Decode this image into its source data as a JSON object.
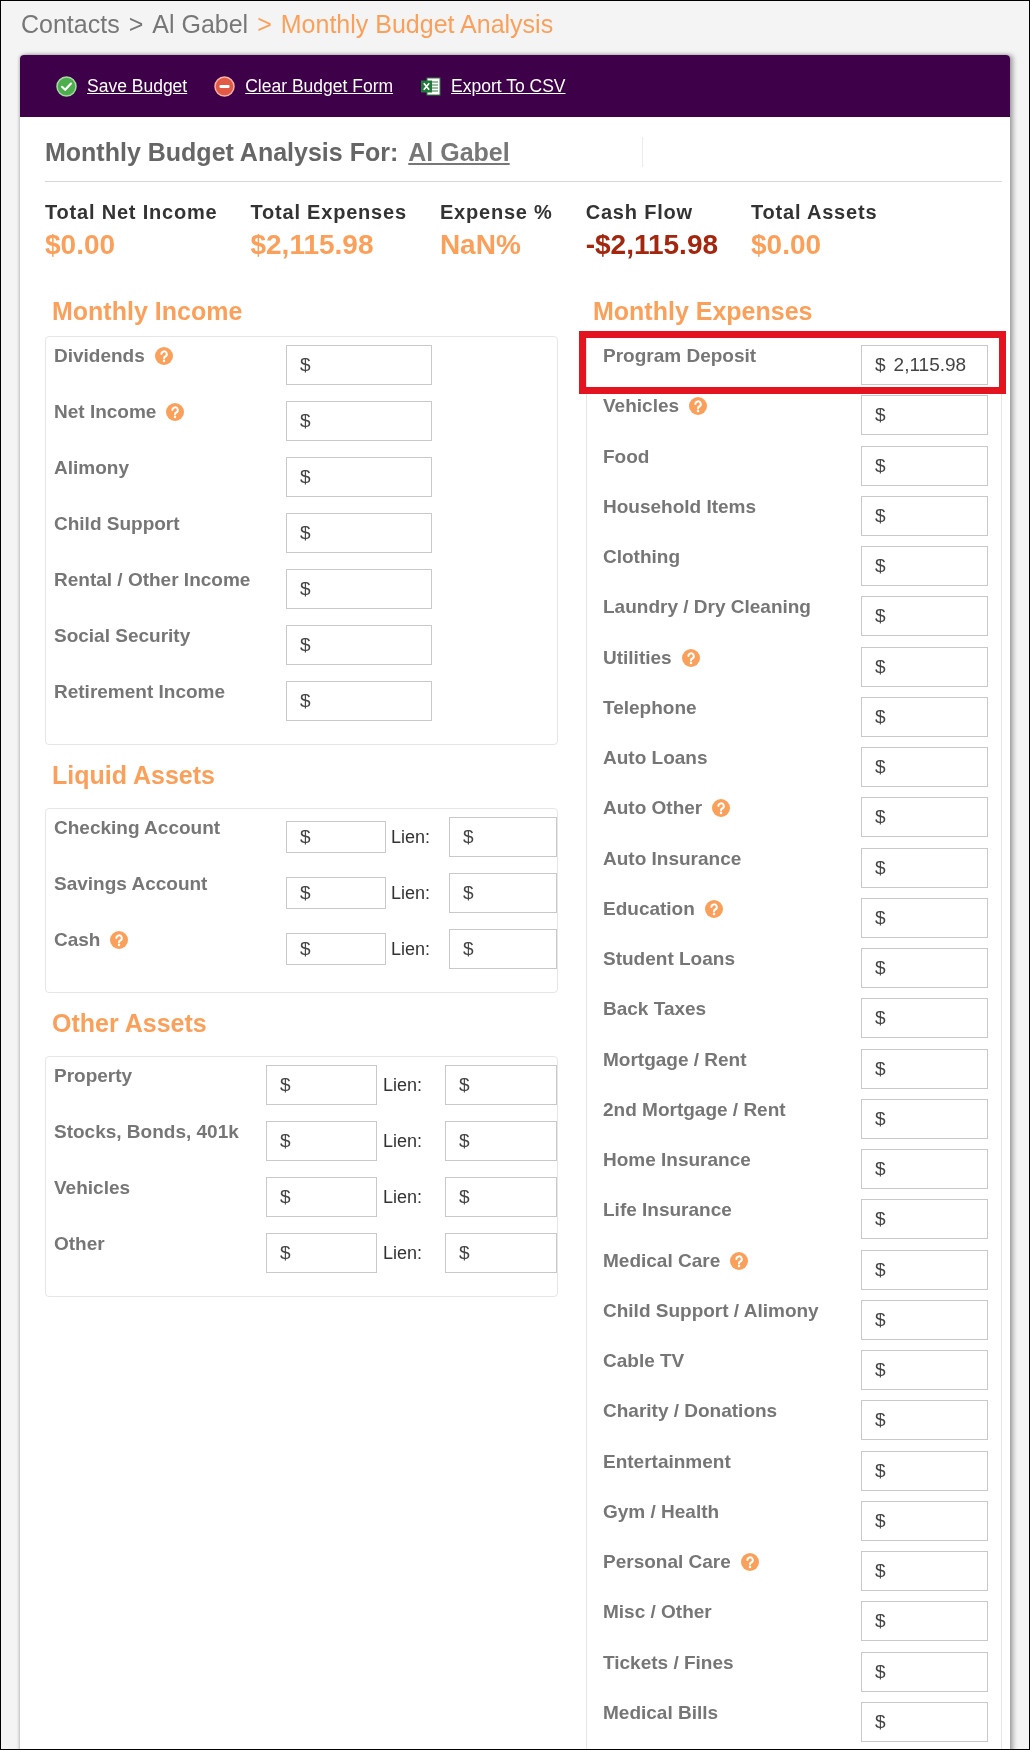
{
  "breadcrumb": [
    {
      "label": "Contacts",
      "current": false
    },
    {
      "separator": ">",
      "label": "Al Gabel",
      "current": false
    },
    {
      "separator": ">",
      "label": "Monthly Budget Analysis",
      "current": true
    }
  ],
  "toolbar": [
    {
      "kind": "save",
      "label": "Save Budget"
    },
    {
      "kind": "clear",
      "label": "Clear Budget Form"
    },
    {
      "kind": "export",
      "label": "Export To CSV"
    }
  ],
  "heading": {
    "label": "Monthly Budget Analysis For:",
    "client": "Al Gabel"
  },
  "summary": [
    {
      "label": "Total Net Income",
      "value": "$0.00",
      "negative": false
    },
    {
      "label": "Total Expenses",
      "value": "$2,115.98",
      "negative": false
    },
    {
      "label": "Expense %",
      "value": "NaN%",
      "negative": false
    },
    {
      "label": "Cash Flow",
      "value": "-$2,115.98",
      "negative": true
    },
    {
      "label": "Total Assets",
      "value": "$0.00",
      "negative": false
    }
  ],
  "left_sections": [
    {
      "kind": "income",
      "title": "Monthly Income",
      "items": [
        {
          "label": "Dividends",
          "help": true,
          "prefix": "$"
        },
        {
          "label": "Net Income",
          "help": true,
          "prefix": "$"
        },
        {
          "label": "Alimony",
          "help": false,
          "prefix": "$"
        },
        {
          "label": "Child Support",
          "help": false,
          "prefix": "$"
        },
        {
          "label": "Rental / Other Income",
          "help": false,
          "prefix": "$"
        },
        {
          "label": "Social Security",
          "help": false,
          "prefix": "$"
        },
        {
          "label": "Retirement Income",
          "help": false,
          "prefix": "$"
        }
      ]
    },
    {
      "kind": "liquid",
      "title": "Liquid Assets",
      "items": [
        {
          "label": "Checking Account",
          "help": false,
          "prefix": "$",
          "lien_label": "Lien:",
          "lien_prefix": "$"
        },
        {
          "label": "Savings Account",
          "help": false,
          "prefix": "$",
          "lien_label": "Lien:",
          "lien_prefix": "$"
        },
        {
          "label": "Cash",
          "help": true,
          "prefix": "$",
          "lien_label": "Lien:",
          "lien_prefix": "$"
        }
      ]
    },
    {
      "kind": "assets",
      "title": "Other Assets",
      "items": [
        {
          "label": "Property",
          "help": false,
          "prefix": "$",
          "lien_label": "Lien:",
          "lien_prefix": "$"
        },
        {
          "label": "Stocks, Bonds, 401k",
          "help": false,
          "prefix": "$",
          "lien_label": "Lien:",
          "lien_prefix": "$"
        },
        {
          "label": "Vehicles",
          "help": false,
          "prefix": "$",
          "lien_label": "Lien:",
          "lien_prefix": "$"
        },
        {
          "label": "Other",
          "help": false,
          "prefix": "$",
          "lien_label": "Lien:",
          "lien_prefix": "$"
        }
      ]
    }
  ],
  "expenses": {
    "title": "Monthly Expenses",
    "items": [
      {
        "label": "Program Deposit",
        "help": false,
        "highlighted": true,
        "prefix": "$",
        "value": "2,115.98"
      },
      {
        "label": "Vehicles",
        "help": true,
        "highlighted": false,
        "prefix": "$"
      },
      {
        "label": "Food",
        "help": false,
        "highlighted": false,
        "prefix": "$"
      },
      {
        "label": "Household Items",
        "help": false,
        "highlighted": false,
        "prefix": "$"
      },
      {
        "label": "Clothing",
        "help": false,
        "highlighted": false,
        "prefix": "$"
      },
      {
        "label": "Laundry / Dry Cleaning",
        "help": false,
        "highlighted": false,
        "prefix": "$"
      },
      {
        "label": "Utilities",
        "help": true,
        "highlighted": false,
        "prefix": "$"
      },
      {
        "label": "Telephone",
        "help": false,
        "highlighted": false,
        "prefix": "$"
      },
      {
        "label": "Auto Loans",
        "help": false,
        "highlighted": false,
        "prefix": "$"
      },
      {
        "label": "Auto Other",
        "help": true,
        "highlighted": false,
        "prefix": "$"
      },
      {
        "label": "Auto Insurance",
        "help": false,
        "highlighted": false,
        "prefix": "$"
      },
      {
        "label": "Education",
        "help": true,
        "highlighted": false,
        "prefix": "$"
      },
      {
        "label": "Student Loans",
        "help": false,
        "highlighted": false,
        "prefix": "$"
      },
      {
        "label": "Back Taxes",
        "help": false,
        "highlighted": false,
        "prefix": "$"
      },
      {
        "label": "Mortgage / Rent",
        "help": false,
        "highlighted": false,
        "prefix": "$"
      },
      {
        "label": "2nd Mortgage / Rent",
        "help": false,
        "highlighted": false,
        "prefix": "$"
      },
      {
        "label": "Home Insurance",
        "help": false,
        "highlighted": false,
        "prefix": "$"
      },
      {
        "label": "Life Insurance",
        "help": false,
        "highlighted": false,
        "prefix": "$"
      },
      {
        "label": "Medical Care",
        "help": true,
        "highlighted": false,
        "prefix": "$"
      },
      {
        "label": "Child Support / Alimony",
        "help": false,
        "highlighted": false,
        "prefix": "$"
      },
      {
        "label": "Cable TV",
        "help": false,
        "highlighted": false,
        "prefix": "$"
      },
      {
        "label": "Charity / Donations",
        "help": false,
        "highlighted": false,
        "prefix": "$"
      },
      {
        "label": "Entertainment",
        "help": false,
        "highlighted": false,
        "prefix": "$"
      },
      {
        "label": "Gym / Health",
        "help": false,
        "highlighted": false,
        "prefix": "$"
      },
      {
        "label": "Personal Care",
        "help": true,
        "highlighted": false,
        "prefix": "$"
      },
      {
        "label": "Misc / Other",
        "help": false,
        "highlighted": false,
        "prefix": "$"
      },
      {
        "label": "Tickets / Fines",
        "help": false,
        "highlighted": false,
        "prefix": "$"
      },
      {
        "label": "Medical Bills",
        "help": false,
        "highlighted": false,
        "prefix": "$"
      }
    ]
  }
}
